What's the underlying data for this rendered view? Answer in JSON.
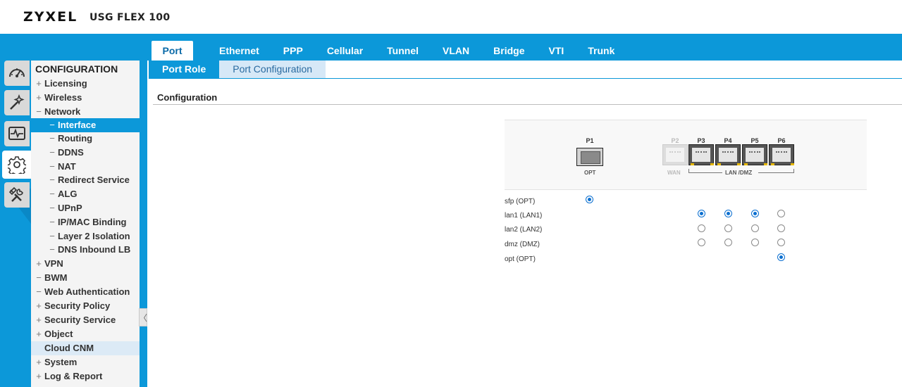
{
  "brand": {
    "logo": "ZYXEL",
    "model": "USG FLEX 100"
  },
  "rail": [
    {
      "name": "dashboard-icon",
      "active": false
    },
    {
      "name": "quick-setup-icon",
      "active": false
    },
    {
      "name": "monitor-icon",
      "active": false
    },
    {
      "name": "configuration-gear-icon",
      "active": true
    },
    {
      "name": "maintenance-tools-icon",
      "active": false
    }
  ],
  "sidebar": {
    "title": "CONFIGURATION",
    "items": [
      {
        "sign": "+",
        "label": "Licensing"
      },
      {
        "sign": "+",
        "label": "Wireless"
      },
      {
        "sign": "−",
        "label": "Network"
      },
      {
        "sign": "−",
        "label": "Interface"
      },
      {
        "sign": "−",
        "label": "Routing"
      },
      {
        "sign": "−",
        "label": "DDNS"
      },
      {
        "sign": "−",
        "label": "NAT"
      },
      {
        "sign": "−",
        "label": "Redirect Service"
      },
      {
        "sign": "−",
        "label": "ALG"
      },
      {
        "sign": "−",
        "label": "UPnP"
      },
      {
        "sign": "−",
        "label": "IP/MAC Binding"
      },
      {
        "sign": "−",
        "label": "Layer 2 Isolation"
      },
      {
        "sign": "−",
        "label": "DNS Inbound LB"
      },
      {
        "sign": "+",
        "label": "VPN"
      },
      {
        "sign": "−",
        "label": "BWM"
      },
      {
        "sign": "−",
        "label": "Web Authentication"
      },
      {
        "sign": "+",
        "label": "Security Policy"
      },
      {
        "sign": "+",
        "label": "Security Service"
      },
      {
        "sign": "+",
        "label": "Object"
      },
      {
        "sign": "",
        "label": "Cloud CNM"
      },
      {
        "sign": "+",
        "label": "System"
      },
      {
        "sign": "+",
        "label": "Log & Report"
      }
    ],
    "collapse_glyph": "〈"
  },
  "tabs": [
    "Port",
    "Ethernet",
    "PPP",
    "Cellular",
    "Tunnel",
    "VLAN",
    "Bridge",
    "VTI",
    "Trunk"
  ],
  "subtabs": [
    "Port Role",
    "Port Configuration"
  ],
  "section": {
    "title": "Configuration"
  },
  "device": {
    "ports": [
      "P1",
      "P2",
      "P3",
      "P4",
      "P5",
      "P6"
    ],
    "opt_caption": "OPT",
    "wan_caption": "WAN",
    "lan_caption": "LAN /DMZ"
  },
  "roles": [
    {
      "label": "sfp (OPT)",
      "selected": [
        "P1"
      ]
    },
    {
      "label": "lan1 (LAN1)",
      "selected": [
        "P3",
        "P4",
        "P5"
      ]
    },
    {
      "label": "lan2 (LAN2)",
      "selected": []
    },
    {
      "label": "dmz (DMZ)",
      "selected": []
    },
    {
      "label": "opt (OPT)",
      "selected": [
        "P6"
      ]
    }
  ],
  "colors": {
    "accent": "#0c98d9",
    "radio": "#0b6fd0",
    "sidebar_bg": "#f4f4f4"
  }
}
